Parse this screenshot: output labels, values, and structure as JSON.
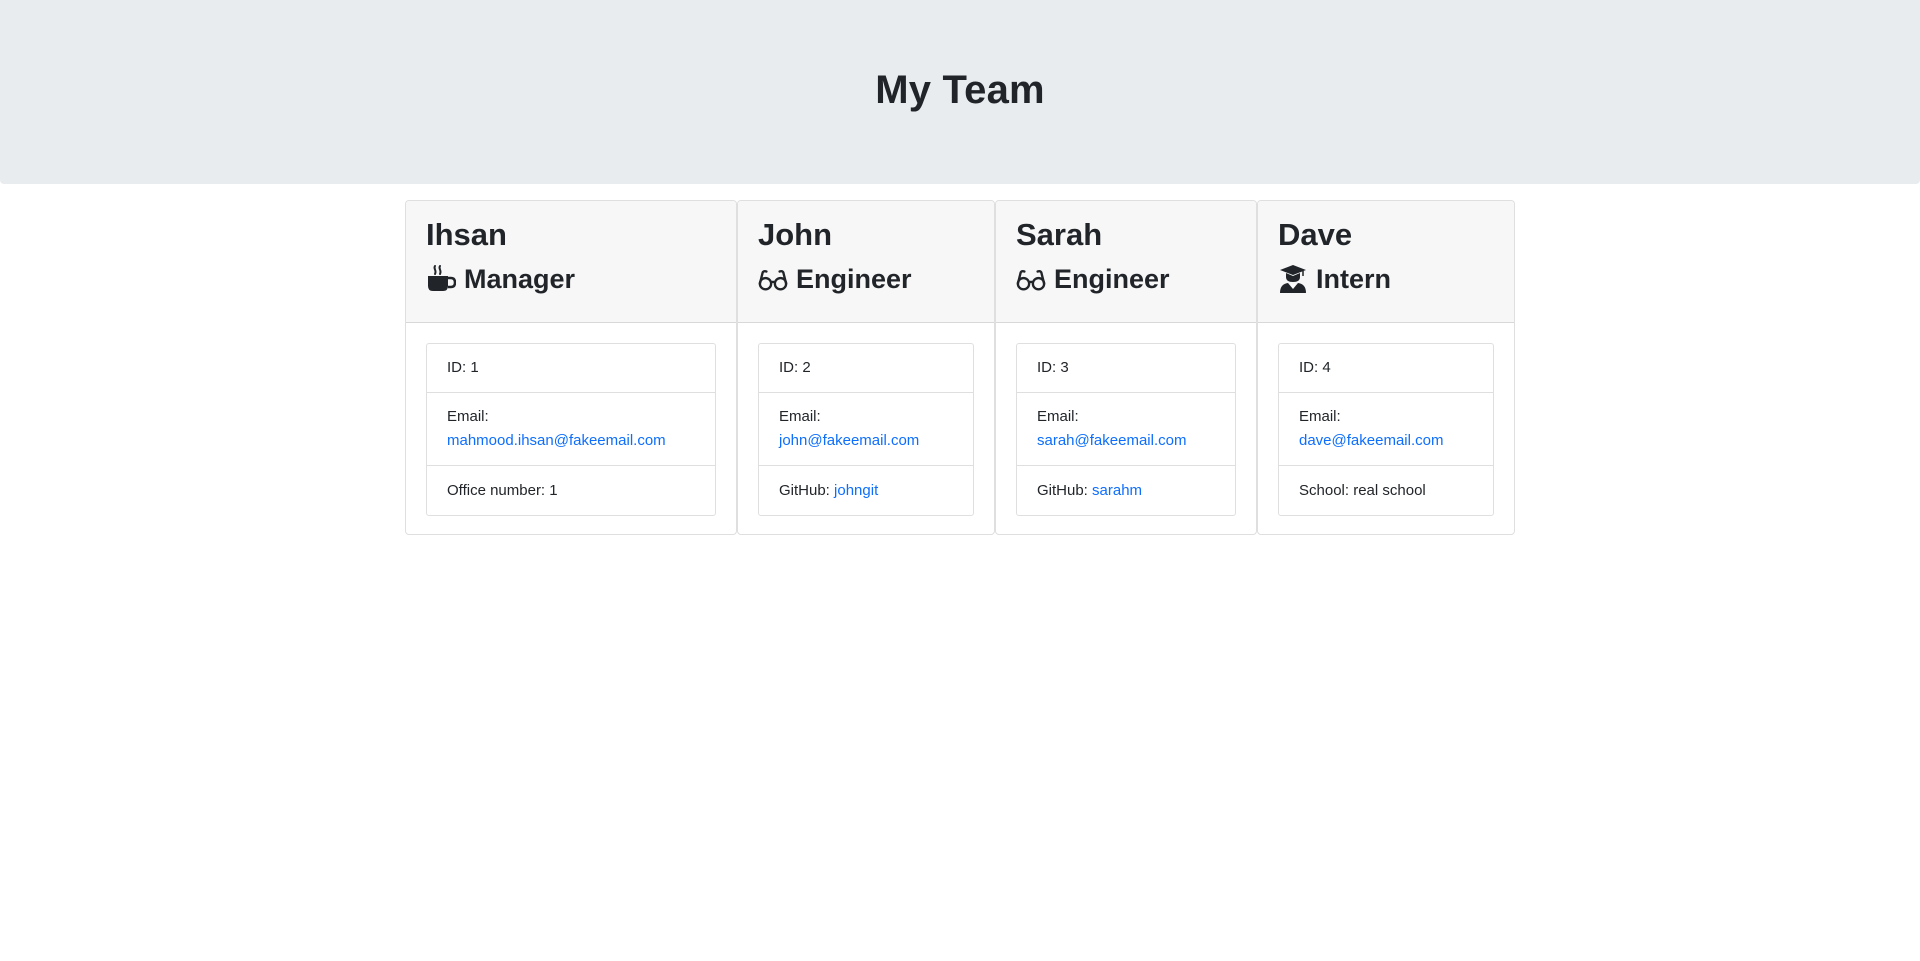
{
  "header": {
    "title": "My Team"
  },
  "employees": [
    {
      "name": "Ihsan",
      "role": "Manager",
      "icon": "coffee-mug-icon",
      "id_text": "ID: 1",
      "email_label": "Email:",
      "email": "mahmood.ihsan@fakeemail.com",
      "extra_label": "Office number: 1",
      "extra_link": ""
    },
    {
      "name": "John",
      "role": "Engineer",
      "icon": "glasses-icon",
      "id_text": "ID: 2",
      "email_label": "Email:",
      "email": "john@fakeemail.com",
      "extra_label": "GitHub:",
      "extra_link": "johngit"
    },
    {
      "name": "Sarah",
      "role": "Engineer",
      "icon": "glasses-icon",
      "id_text": "ID: 3",
      "email_label": "Email:",
      "email": "sarah@fakeemail.com",
      "extra_label": "GitHub:",
      "extra_link": "sarahm"
    },
    {
      "name": "Dave",
      "role": "Intern",
      "icon": "graduate-icon",
      "id_text": "ID: 4",
      "email_label": "Email:",
      "email": "dave@fakeemail.com",
      "extra_label": "School: real school",
      "extra_link": ""
    }
  ],
  "colors": {
    "link": "#0d6efd",
    "header_bg": "#e9ecef",
    "card_header_bg": "#f7f7f7",
    "text": "#212529"
  }
}
